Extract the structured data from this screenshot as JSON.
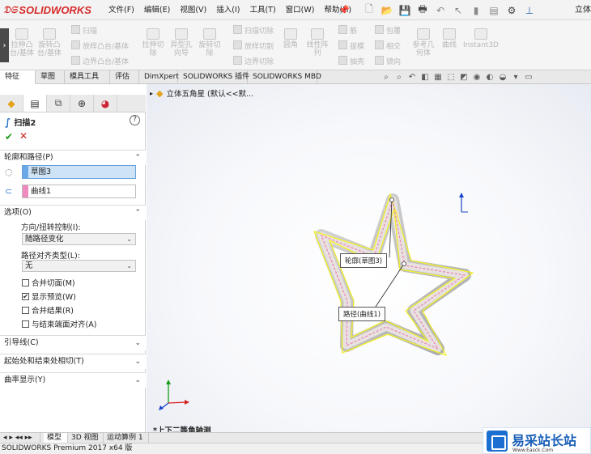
{
  "app": {
    "logo_text": "SOLIDWORKS",
    "brand_color": "#d62b2b",
    "title_right": "立体"
  },
  "menu": [
    "文件(F)",
    "编辑(E)",
    "视图(V)",
    "插入(I)",
    "工具(T)",
    "窗口(W)",
    "帮助(H)"
  ],
  "ribbon": {
    "extrude_boss": "拉伸凸\n台/基体",
    "revolve_boss": "旋转凸\n台/基体",
    "sweep": "扫描",
    "loft_boss": "放样凸台/基体",
    "boundary_boss": "边界凸台/基体",
    "extrude_cut": "拉伸切\n除",
    "hole_wizard": "异型孔\n向导",
    "revolve_cut": "旋转切\n除",
    "swept_cut": "扫描切除",
    "lofted_cut": "放样切割",
    "boundary_cut": "边界切除",
    "fillet": "圆角",
    "linear_pattern": "线性阵\n列",
    "rib": "筋",
    "draft": "拔模",
    "shell": "抽壳",
    "wrap": "包覆",
    "intersect": "相交",
    "mirror": "镜向",
    "ref_geometry": "参考几\n何体",
    "curves": "曲线",
    "instant3d": "Instant3D"
  },
  "tabs": [
    "特征",
    "草图",
    "模具工具",
    "评估",
    "DimXpert",
    "SOLIDWORKS 插件",
    "SOLIDWORKS MBD"
  ],
  "property_manager": {
    "title": "扫描2",
    "help": "?",
    "ok": "✔",
    "cancel": "✕",
    "section_profile": "轮廓和路径(P)",
    "profile_value": "草图3",
    "profile_color": "#6aa9e8",
    "path_value": "曲线1",
    "path_color": "#f08bbf",
    "section_options": "选项(O)",
    "twist_label": "方向/扭转控制(I):",
    "twist_value": "随路径变化",
    "align_label": "路径对齐类型(L):",
    "align_value": "无",
    "check_merge_tangent": "合并切面(M)",
    "check_show_preview": "显示预览(W)",
    "check_merge_result": "合并结果(R)",
    "check_align_end": "与结束端面对齐(A)",
    "show_preview_checked": "✔",
    "section_guides": "引导线(C)",
    "section_tangency": "起始处和结束处相切(T)",
    "section_curvature": "曲率显示(Y)"
  },
  "viewport": {
    "tree_label": "立体五角星  (默认<<默...",
    "callout_profile": "轮廓(草图3)",
    "callout_path": "路径(曲线1)",
    "view_label": "*上下二等角轴测"
  },
  "bottom_tabs": [
    "模型",
    "3D 视图",
    "运动算例 1"
  ],
  "status": "SOLIDWORKS Premium 2017 x64 版",
  "watermark": {
    "text": "易采站长站",
    "url": "Www.Easck.Com"
  }
}
